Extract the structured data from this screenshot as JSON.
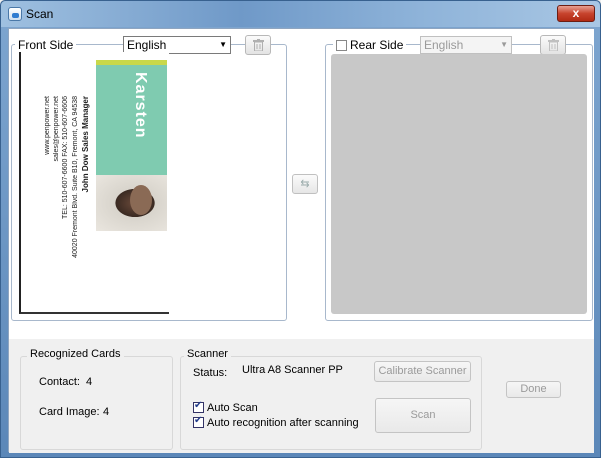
{
  "window": {
    "title": "Scan",
    "close_label": "x"
  },
  "front": {
    "label": "Front Side",
    "language": "English",
    "card": {
      "brand": "Karsten",
      "name_line": "John Dow   Sales Manager",
      "address_line": "40020 Fremont Blvd. Suite B10, Fremont, CA 94538",
      "phone_line": "TEL: 510-607-6600   FAX: 510-607-6606",
      "email_line": "sales@penpower.net",
      "web_line": "www.penpower.net"
    }
  },
  "rear": {
    "label": "Rear Side",
    "language": "English",
    "checked": false
  },
  "recognized": {
    "title": "Recognized Cards",
    "contact_label": "Contact:",
    "contact_value": "4",
    "card_image_label": "Card Image:",
    "card_image_value": "4"
  },
  "scanner": {
    "title": "Scanner",
    "status_label": "Status:",
    "status_value": "Ultra A8 Scanner PP",
    "calibrate_label": "Calibrate Scanner",
    "auto_scan_label": "Auto Scan",
    "auto_scan_checked": true,
    "auto_recog_label": "Auto recognition after scanning",
    "auto_recog_checked": true,
    "scan_label": "Scan"
  },
  "done_label": "Done"
}
